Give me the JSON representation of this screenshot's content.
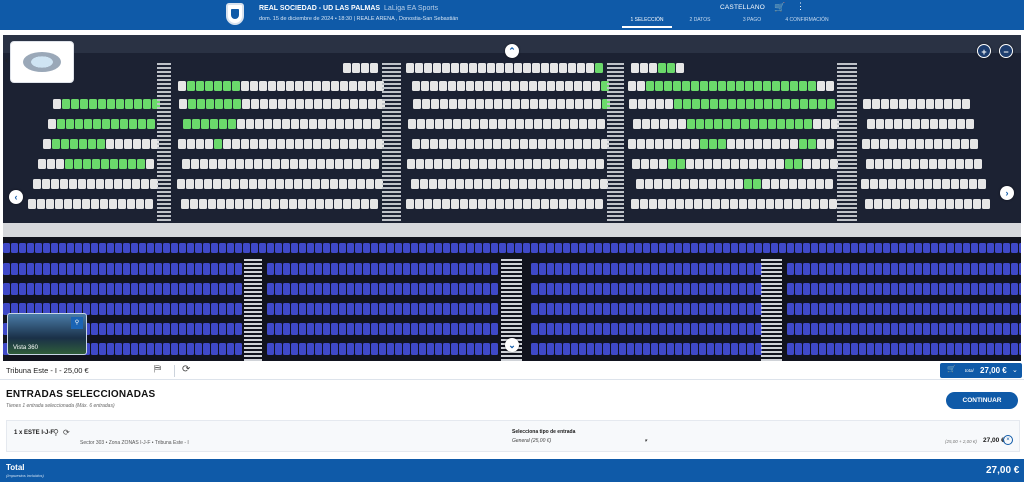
{
  "header": {
    "match": "REAL SOCIEDAD - UD LAS PALMAS",
    "league": "LaLiga EA Sports",
    "info": "dom. 15 de diciembre de 2024 • 18:30 | REALE ARENA , Donostia-San Sebastián",
    "language": "CASTELLANO",
    "steps": [
      {
        "label": "1 SELECCIÓN"
      },
      {
        "label": "2 DATOS"
      },
      {
        "label": "3 PAGO"
      },
      {
        "label": "4 CONFIRMACIÓN"
      }
    ]
  },
  "map": {
    "vista_label": "Vista 360",
    "zoom_in": "+",
    "zoom_out": "−",
    "nav_up": "^",
    "nav_down": "v",
    "nav_left": "<",
    "nav_right": ">",
    "seat_colors": {
      "available": "#6bd96b",
      "unavailable": "#e6e6e6",
      "selected": "#f4b63f",
      "lower_tier": "#3f49c8"
    }
  },
  "infobar": {
    "sector": "Tribuna Este - I - 25,00 €",
    "total_label": "total",
    "total_value": "27,00 €"
  },
  "entradas": {
    "title": "ENTRADAS SELECCIONADAS",
    "hint": "Tienes 1 entrada seleccionada (Máx. 6 entradas)",
    "continue": "CONTINUAR",
    "ticket": {
      "name": "1 x ESTE I-J-F",
      "description": "Sector 303 • Zona ZONAS I-J-F • Tribuna Este - I",
      "type_label": "Selecciona tipo de entrada",
      "type_value": "General (25,00 €)",
      "breakdown": "(25,00 + 2,00 €)",
      "price": "27,00 €"
    }
  },
  "footer": {
    "label": "Total",
    "sub": "(Impuestos incluidos)",
    "value": "27,00 €"
  }
}
